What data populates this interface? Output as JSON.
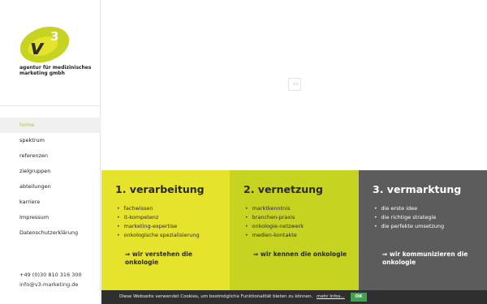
{
  "brand": {
    "logo_text": "v3",
    "tagline": "agentur für medizinisches marketing gmbh",
    "colors": {
      "yellow": "#e6e32d",
      "lime": "#c6d321",
      "dark": "#5c5c5c"
    }
  },
  "nav": {
    "items": [
      {
        "label": "home",
        "active": true
      },
      {
        "label": "spektrum"
      },
      {
        "label": "referenzen"
      },
      {
        "label": "zielgruppen"
      },
      {
        "label": "abteilungen"
      },
      {
        "label": "karriere"
      },
      {
        "label": "Impressum"
      },
      {
        "label": "Datenschutzerklärung"
      }
    ]
  },
  "contact": {
    "phone": "+49 (0)30 810 316 300",
    "email": "info@v3-marketing.de"
  },
  "columns": [
    {
      "title": "1. verarbeitung",
      "items": [
        "fachwissen",
        "it-kompetenz",
        "marketing-expertise",
        "onkologische spezialisierung"
      ],
      "cta": "⇒ wir verstehen die onkologie"
    },
    {
      "title": "2. vernetzung",
      "items": [
        "marktkenntnis",
        "branchen-praxis",
        "onkologie-netzwerk",
        "medien-kontakte"
      ],
      "cta": "⇒ wir kennen die onkologie"
    },
    {
      "title": "3. vermarktung",
      "items": [
        "die erste idee",
        "die richtige strategie",
        "die perfekte umsetzung"
      ],
      "cta": "⇒ wir kommunizieren die onkologie"
    }
  ],
  "cookie": {
    "message": "Diese Webseite verwendet Cookies, um bestmögliche Funktionalität bieten zu können.",
    "more_label": "mehr Infos...",
    "ok_label": "OK"
  },
  "spinner": {
    "icon": "loading-spinner-icon"
  }
}
